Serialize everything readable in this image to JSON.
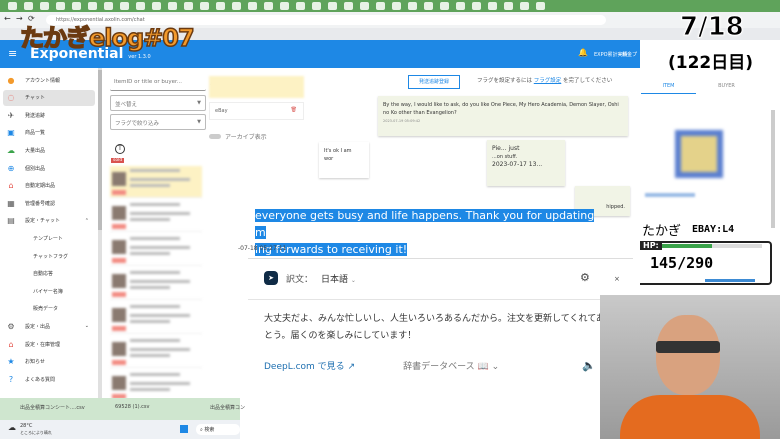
{
  "browser": {
    "url": "https://exponential.axolin.com/chat"
  },
  "overlay": {
    "title": "たかぎelog#07",
    "date": "7/18",
    "day": "(122日目)",
    "hp_name": "たかぎ",
    "level": "EBAY:L4",
    "hp_label": "HP:",
    "hp_value": "145/290",
    "hp_current": 145,
    "hp_max": 290
  },
  "header": {
    "brand": "Exponential",
    "version": "ver 1.3.0",
    "notif_count": "4",
    "expo": "EXPO累計実績",
    "fee": "料金プ"
  },
  "sidebar": {
    "items": [
      {
        "label": "アカウント情報",
        "icon": "account-icon"
      },
      {
        "label": "チャット",
        "icon": "chat-icon",
        "active": true
      },
      {
        "label": "発送追跡",
        "icon": "airplane-icon"
      },
      {
        "label": "商品一覧",
        "icon": "gift-icon"
      },
      {
        "label": "大量出品",
        "icon": "cloud-upload-icon"
      },
      {
        "label": "個別出品",
        "icon": "upload-icon"
      },
      {
        "label": "自動定期出品",
        "icon": "robot-icon"
      },
      {
        "label": "管理番号確認",
        "icon": "calendar-icon"
      },
      {
        "label": "設定・チャット",
        "icon": "chat-settings-icon",
        "expanded": true
      },
      {
        "label": "テンプレート",
        "sub": true
      },
      {
        "label": "チャットフラグ",
        "sub": true
      },
      {
        "label": "自動応答",
        "sub": true
      },
      {
        "label": "バイヤー名簿",
        "sub": true
      },
      {
        "label": "販売データ",
        "sub": true
      },
      {
        "label": "設定・出品",
        "icon": "gear-icon"
      },
      {
        "label": "設定・在庫管理",
        "icon": "robot-icon"
      },
      {
        "label": "お知らせ",
        "icon": "star-icon"
      },
      {
        "label": "よくある質問",
        "icon": "help-icon"
      }
    ]
  },
  "list": {
    "search_placeholder": "ItemID or title or buyer...",
    "sort": "並べ替え",
    "filter": "フラグで絞り込み",
    "sold": "sold"
  },
  "chat": {
    "ebay": "eBay",
    "archive": "アーカイブ表示",
    "tracking_button": "発送追跡登録",
    "flag_note_pre": "フラグを設定するには",
    "flag_link": "フラグ設定",
    "flag_note_post": "を完了してください",
    "msg1": "By the way, I would like to ask, do you like One Piece, My Hero Academia, Demon Slayer, Oshi no Ko other than Evangelion?",
    "msg1_time": "2023-07-19 05:09:42",
    "msg2": "It's ok I am",
    "msg2b": "wor",
    "msg3": "Pie... just",
    "msg3b": "...on stuff.",
    "msg3_time": "2023-07-17 13...",
    "shipped": "hipped.",
    "selected1": "everyone gets busy and life happens. Thank you for updating m",
    "selected2": "ing forwards to receiving it!",
    "sel_time": "-07-18 05:27:11"
  },
  "right": {
    "tabs": [
      "ITEM",
      "BUYER"
    ]
  },
  "deepl": {
    "label": "訳文：",
    "lang": "日本語",
    "translation": "大丈夫だよ、みんな忙しいし、人生いろいろあるんだから。注文を更新してくれてありがとう。届くのを楽しみにしています！",
    "link": "DeepL.com で見る",
    "dict": "辞書データベース"
  },
  "downloads": [
    "出品全積算コンシート....csv",
    "69528 (1).csv",
    "出品全積算コン"
  ],
  "taskbar": {
    "weather": "28°C",
    "weather_sub": "ところにより晴れ",
    "search": "検索"
  }
}
